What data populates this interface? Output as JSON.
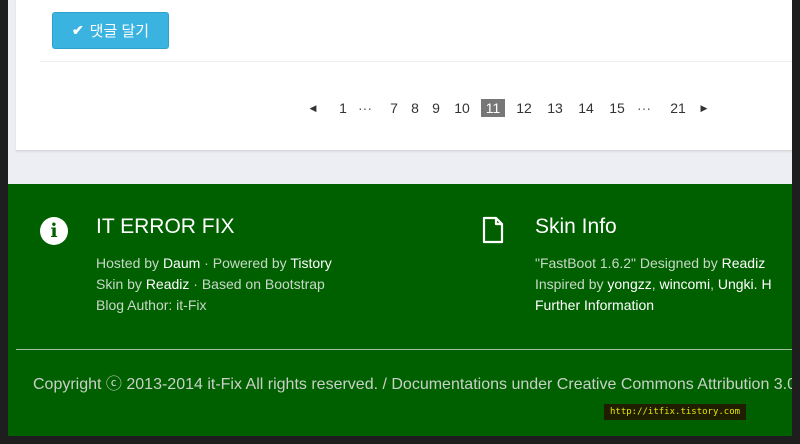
{
  "comment_button": {
    "icon": "check-icon",
    "label": "댓글 달기"
  },
  "pagination": {
    "prev_icon": "◀",
    "next_icon": "▶",
    "items": [
      {
        "label": "1"
      },
      {
        "label": "···",
        "ellipsis": true
      },
      {
        "label": "7"
      },
      {
        "label": "8"
      },
      {
        "label": "9"
      },
      {
        "label": "10"
      },
      {
        "label": "11",
        "current": true
      },
      {
        "label": "12"
      },
      {
        "label": "13"
      },
      {
        "label": "14"
      },
      {
        "label": "15"
      },
      {
        "label": "···",
        "ellipsis": true
      },
      {
        "label": "21"
      }
    ]
  },
  "footer": {
    "background": "#006000",
    "left": {
      "icon": "info-icon",
      "title": "IT ERROR FIX",
      "line1": {
        "a": "Hosted by ",
        "b": "Daum",
        "c": " · Powered by ",
        "d": "Tistory"
      },
      "line2": {
        "a": "Skin by ",
        "b": "Readiz",
        "c": " · Based on Bootstrap"
      },
      "line3": "Blog Author: it-Fix"
    },
    "right": {
      "icon": "file-icon",
      "title": "Skin Info",
      "line1": {
        "a": "\"FastBoot 1.6.2\" Designed by ",
        "b": "Readiz"
      },
      "line2": {
        "a": "Inspired by ",
        "b": "yongzz",
        "c": ", ",
        "d": "wincomi",
        "e": ", ",
        "f": "Ungki",
        "g": ". H"
      },
      "line3": "Further Information"
    },
    "copyright": "Copyright ⓒ 2013-2014 it-Fix All rights reserved. / Documentations under Creative Commons Attribution 3.0",
    "watermark": "http://itfix.tistory.com"
  }
}
